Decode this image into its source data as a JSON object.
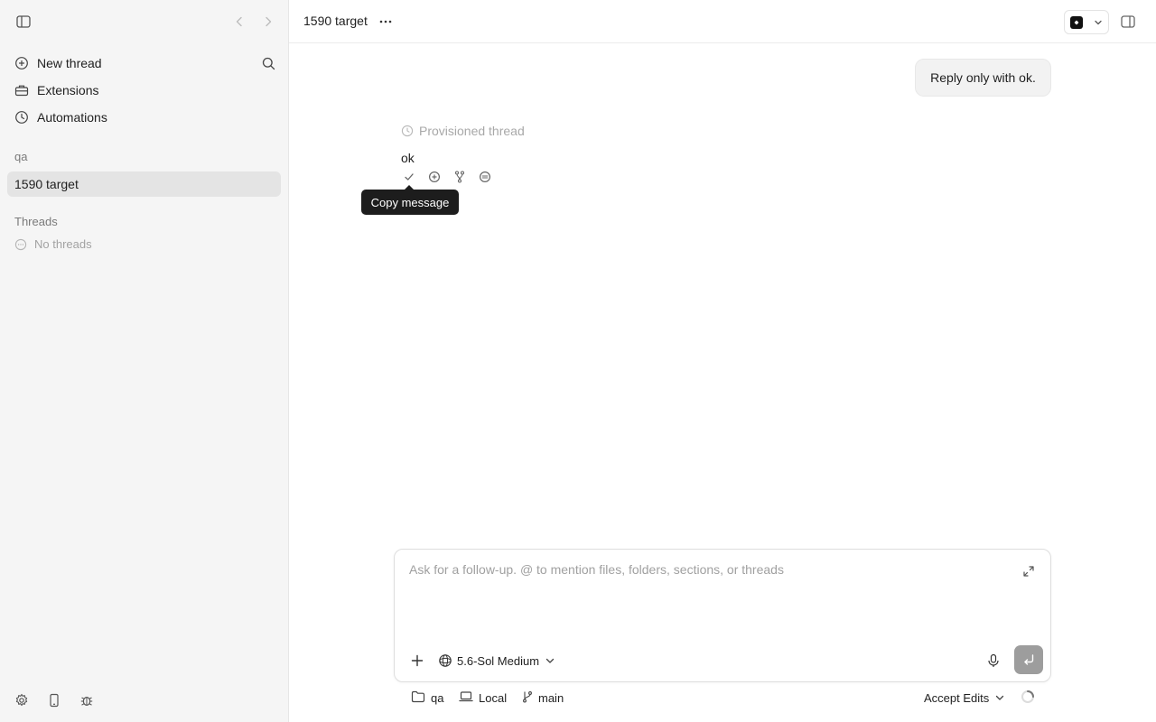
{
  "sidebar": {
    "items": [
      {
        "label": "New thread",
        "icon": "plus-circle-icon"
      },
      {
        "label": "Extensions",
        "icon": "toolbox-icon"
      },
      {
        "label": "Automations",
        "icon": "clock-icon"
      }
    ],
    "project_group": "qa",
    "active_thread": "1590 target",
    "threads_heading": "Threads",
    "threads_empty": "No threads"
  },
  "header": {
    "title": "1590 target"
  },
  "conversation": {
    "user_message": "Reply only with ok.",
    "provisioned_label": "Provisioned thread",
    "assistant_reply": "ok",
    "tooltip": "Copy message"
  },
  "composer": {
    "placeholder": "Ask for a follow-up. @ to mention files, folders, sections, or threads",
    "model_label": "5.6-Sol Medium"
  },
  "footer": {
    "folder": "qa",
    "environment": "Local",
    "branch": "main",
    "edit_mode": "Accept Edits"
  },
  "colors": {
    "sidebar_bg": "#f5f5f5",
    "selected_bg": "#e4e4e4",
    "tooltip_bg": "#1d1d1d",
    "send_button": "#9d9d9d"
  }
}
